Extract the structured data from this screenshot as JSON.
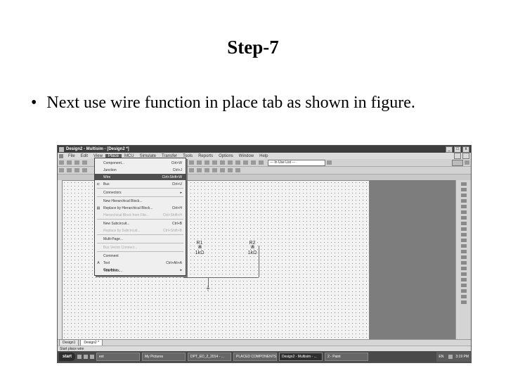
{
  "slide": {
    "title": "Step-7",
    "bullet_marker": "•",
    "bullet_text": "Next use wire function in place tab as shown in figure."
  },
  "window": {
    "title": "Design2 - Multisim - [Design2 *]",
    "minimize": "_",
    "maximize": "□",
    "close": "x"
  },
  "menubar": {
    "items": [
      "File",
      "Edit",
      "View",
      "Place",
      "MCU",
      "Simulate",
      "Transfer",
      "Tools",
      "Reports",
      "Options",
      "Window",
      "Help"
    ]
  },
  "toolbar": {
    "combo_value": "--- In Use List ---"
  },
  "place_menu": {
    "items": [
      {
        "icon": "",
        "label": "Component...",
        "shortcut": "Ctrl+W",
        "disabled": false
      },
      {
        "icon": "",
        "label": "Junction",
        "shortcut": "Ctrl+J",
        "disabled": false
      },
      {
        "icon": "",
        "label": "Wire",
        "shortcut": "Ctrl+Shift+W",
        "disabled": false,
        "highlighted": true
      },
      {
        "icon": "⊏",
        "label": "Bus",
        "shortcut": "Ctrl+U",
        "disabled": false
      },
      {
        "icon": "",
        "label": "Connectors",
        "shortcut": "▸",
        "disabled": false
      },
      {
        "icon": "",
        "label": "New Hierarchical Block...",
        "shortcut": "",
        "disabled": false
      },
      {
        "icon": "▤",
        "label": "Replace by Hierarchical Block...",
        "shortcut": "Ctrl+H",
        "disabled": false
      },
      {
        "icon": "",
        "label": "Hierarchical Block from File...",
        "shortcut": "Ctrl+Shift+H",
        "disabled": true
      },
      {
        "icon": "",
        "label": "New Subcircuit...",
        "shortcut": "Ctrl+B",
        "disabled": false
      },
      {
        "icon": "",
        "label": "Replace by Subcircuit...",
        "shortcut": "Ctrl+Shift+B",
        "disabled": true
      },
      {
        "icon": "",
        "label": "Multi-Page...",
        "shortcut": "",
        "disabled": false
      },
      {
        "icon": "",
        "label": "Bus Vector Connect...",
        "shortcut": "",
        "disabled": true
      },
      {
        "icon": "",
        "label": "Comment",
        "shortcut": "",
        "disabled": false
      },
      {
        "icon": "A",
        "label": "Text",
        "shortcut": "Ctrl+Alt+A",
        "disabled": false
      },
      {
        "icon": "",
        "label": "Graphics",
        "shortcut": "▸",
        "disabled": false
      },
      {
        "icon": "",
        "label": "Title Block...",
        "shortcut": "",
        "disabled": false
      }
    ]
  },
  "schematic": {
    "r1_label": "R1",
    "r1_value": "1kΩ",
    "r2_label": "R2",
    "r2_value": "1kΩ"
  },
  "sheet_tabs": [
    "Design1",
    "Design2 *"
  ],
  "status": {
    "text": "Start place wire"
  },
  "taskbar": {
    "start_label": "start",
    "buttons": [
      "ext",
      "My Pictures",
      "DPT_ED_2_2014 - ...",
      "PLACED COMPONENTS - ...",
      "Design2 - Multisim - ...",
      "2 - Paint"
    ],
    "active_index": 4,
    "lang": "EN",
    "clock": "3:19 PM"
  }
}
